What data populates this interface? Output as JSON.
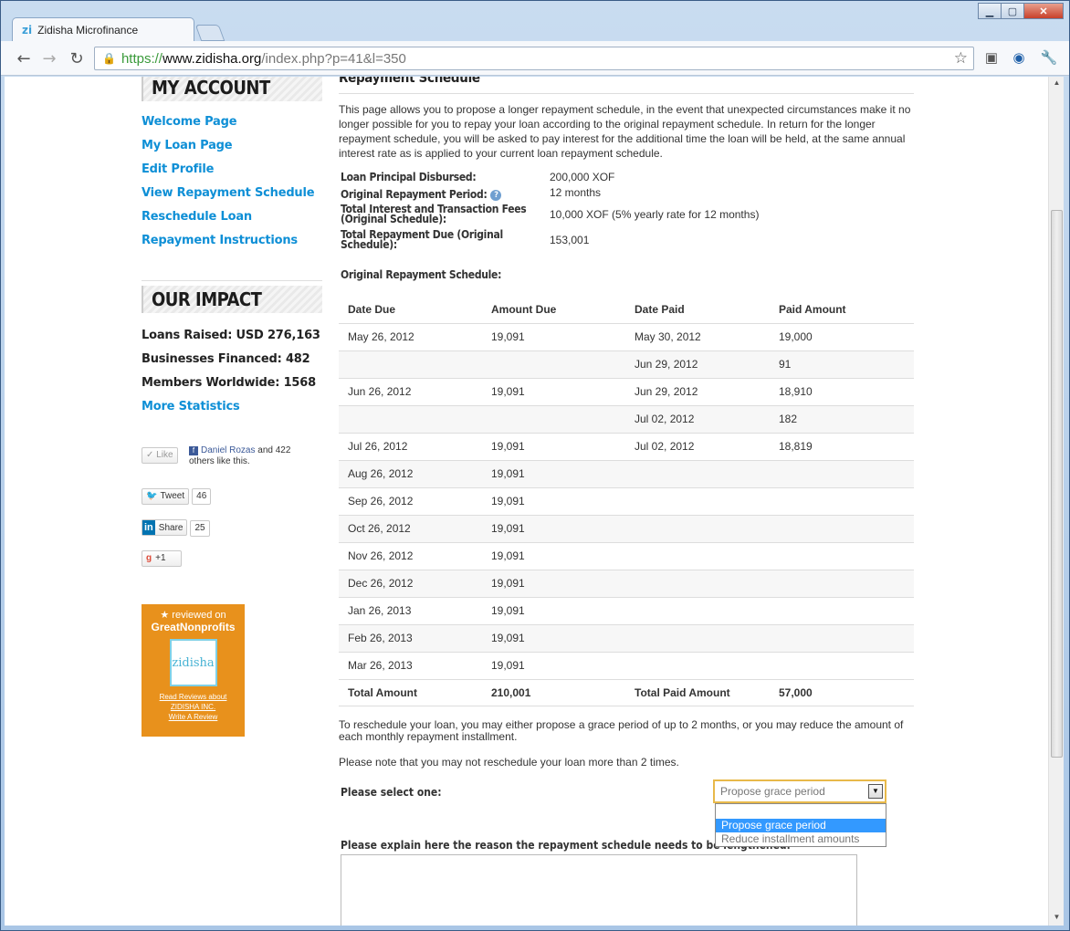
{
  "browser": {
    "tab_title": "Zidisha Microfinance",
    "tab_favicon": "zi",
    "url_https": "https://",
    "url_host": "www.zidisha.org",
    "url_path": "/index.php?p=41&l=350"
  },
  "sidebar": {
    "account_heading": "MY ACCOUNT",
    "account_links": [
      "Welcome Page",
      "My Loan Page",
      "Edit Profile",
      "View Repayment Schedule",
      "Reschedule Loan",
      "Repayment Instructions"
    ],
    "impact_heading": "OUR IMPACT",
    "stats": [
      "Loans Raised: USD 276,163",
      "Businesses Financed: 482",
      "Members Worldwide: 1568"
    ],
    "more_stats": "More Statistics",
    "fb_like": "Like",
    "fb_name": "Daniel Rozas",
    "fb_text": " and 422 others like this.",
    "tweet": "Tweet",
    "tweet_count": "46",
    "li_share": "Share",
    "li_count": "25",
    "gplus": "+1",
    "gnp_reviewed": "reviewed on",
    "gnp_brand": "GreatNonprofits",
    "gnp_logo": "zidisha",
    "gnp_link1": "Read Reviews about",
    "gnp_link2": "ZIDISHA INC.",
    "gnp_link3": "Write A Review"
  },
  "main": {
    "section_title": "Repayment Schedule",
    "intro": "This page allows you to propose a longer repayment schedule, in the event that unexpected circumstances make it no longer possible for you to repay your loan according to the original repayment schedule. In return for the longer repayment schedule, you will be asked to pay interest for the additional time the loan will be held, at the same annual interest rate as is applied to your current loan repayment schedule.",
    "info": [
      {
        "label": "Loan Principal Disbursed:",
        "value": "200,000 XOF"
      },
      {
        "label": "Original Repayment Period:",
        "value": "12 months"
      },
      {
        "label": "Total Interest and Transaction Fees (Original Schedule):",
        "value": "10,000 XOF (5% yearly rate for 12 months)"
      },
      {
        "label": "Total Repayment Due (Original Schedule):",
        "value": "153,001"
      }
    ],
    "schedule_heading": "Original Repayment Schedule:",
    "table_headers": [
      "Date Due",
      "Amount Due",
      "Date Paid",
      "Paid Amount"
    ],
    "rows": [
      [
        "May 26, 2012",
        "19,091",
        "May 30, 2012",
        "19,000"
      ],
      [
        "",
        "",
        "Jun 29, 2012",
        "91"
      ],
      [
        "Jun 26, 2012",
        "19,091",
        "Jun 29, 2012",
        "18,910"
      ],
      [
        "",
        "",
        "Jul 02, 2012",
        "182"
      ],
      [
        "Jul 26, 2012",
        "19,091",
        "Jul 02, 2012",
        "18,819"
      ],
      [
        "Aug 26, 2012",
        "19,091",
        "",
        ""
      ],
      [
        "Sep 26, 2012",
        "19,091",
        "",
        ""
      ],
      [
        "Oct 26, 2012",
        "19,091",
        "",
        ""
      ],
      [
        "Nov 26, 2012",
        "19,091",
        "",
        ""
      ],
      [
        "Dec 26, 2012",
        "19,091",
        "",
        ""
      ],
      [
        "Jan 26, 2013",
        "19,091",
        "",
        ""
      ],
      [
        "Feb 26, 2013",
        "19,091",
        "",
        ""
      ],
      [
        "Mar 26, 2013",
        "19,091",
        "",
        ""
      ]
    ],
    "totals": [
      "Total Amount",
      "210,001",
      "Total Paid Amount",
      "57,000"
    ],
    "reschedule_text": "To reschedule your loan, you may either propose a grace period of up to 2 months, or you may reduce the amount of each monthly repayment installment.",
    "limit_text": "Please note that you may not reschedule your loan more than 2 times.",
    "select_label": "Please select one:",
    "select_value": "Propose grace period",
    "select_options": [
      "",
      "Propose grace period",
      "Reduce installment amounts"
    ],
    "explain_label": "Please explain here the reason the repayment schedule needs to be lengthened."
  }
}
